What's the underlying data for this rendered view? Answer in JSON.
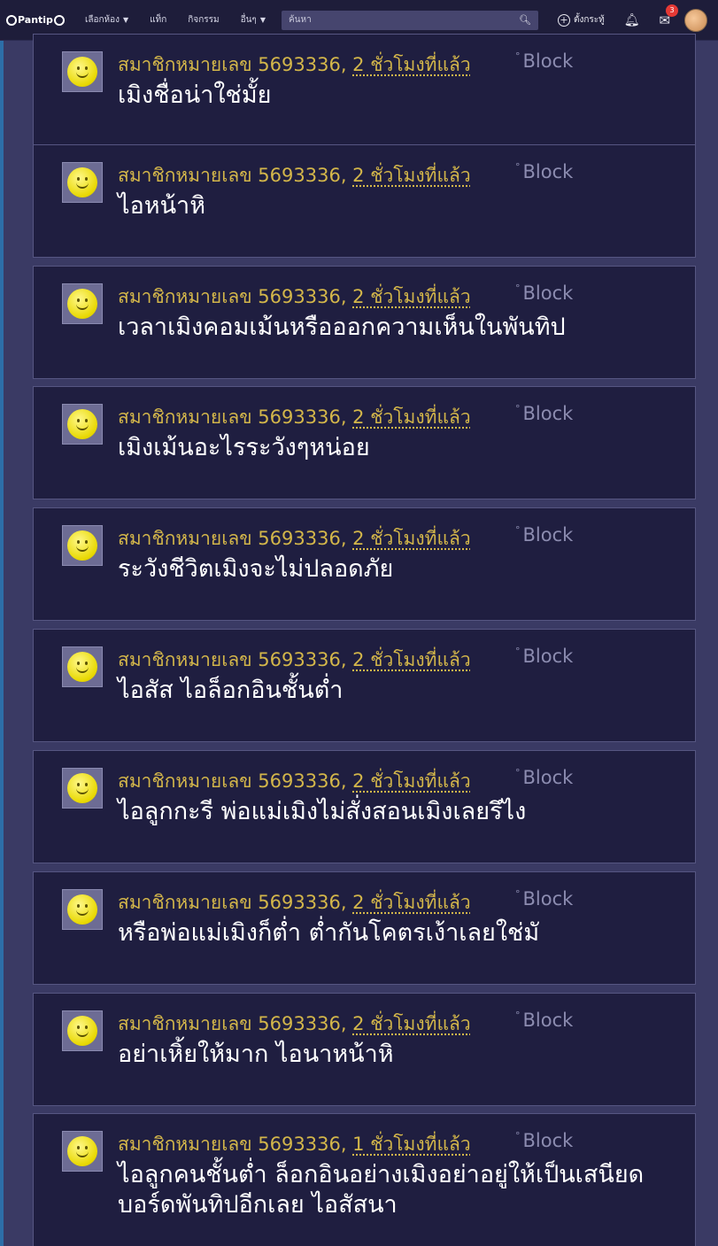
{
  "header": {
    "logo": "Pantip",
    "nav": [
      "เลือกห้อง",
      "แท็ก",
      "กิจกรรม",
      "อื่นๆ"
    ],
    "search_placeholder": "ค้นหา",
    "create_label": "ตั้งกระทู้",
    "mail_badge": "3"
  },
  "comments": [
    {
      "author": "สมาชิกหมายเลข 5693336",
      "time": "2 ชั่วโมงที่แล้ว",
      "block": "Block",
      "text": "เมิงชื่อน่าใช่มั้ย"
    },
    {
      "author": "สมาชิกหมายเลข 5693336",
      "time": "2 ชั่วโมงที่แล้ว",
      "block": "Block",
      "text": "ไอหน้าหิ"
    },
    {
      "author": "สมาชิกหมายเลข 5693336",
      "time": "2 ชั่วโมงที่แล้ว",
      "block": "Block",
      "text": "เวลาเมิงคอมเม้นหรือออกความเห็นในพันทิป"
    },
    {
      "author": "สมาชิกหมายเลข 5693336",
      "time": "2 ชั่วโมงที่แล้ว",
      "block": "Block",
      "text": "เมิงเม้นอะไรระวังๆหน่อย"
    },
    {
      "author": "สมาชิกหมายเลข 5693336",
      "time": "2 ชั่วโมงที่แล้ว",
      "block": "Block",
      "text": "ระวังชีวิตเมิงจะไม่ปลอดภัย"
    },
    {
      "author": "สมาชิกหมายเลข 5693336",
      "time": "2 ชั่วโมงที่แล้ว",
      "block": "Block",
      "text": "ไอสัส ไอล็อกอินชั้นต่ำ"
    },
    {
      "author": "สมาชิกหมายเลข 5693336",
      "time": "2 ชั่วโมงที่แล้ว",
      "block": "Block",
      "text": "ไอลูกกะรี พ่อแม่เมิงไม่สั่งสอนเมิงเลยรึไง"
    },
    {
      "author": "สมาชิกหมายเลข 5693336",
      "time": "2 ชั่วโมงที่แล้ว",
      "block": "Block",
      "text": "หรือพ่อแม่เมิงก็ต่ำ ต่ำกันโคตรเง้าเลยใช่มั"
    },
    {
      "author": "สมาชิกหมายเลข 5693336",
      "time": "2 ชั่วโมงที่แล้ว",
      "block": "Block",
      "text": "อย่าเหิ้ยให้มาก ไอนาหน้าหิ"
    },
    {
      "author": "สมาชิกหมายเลข 5693336",
      "time": "1 ชั่วโมงที่แล้ว",
      "block": "Block",
      "text": "ไอลูกคนชั้นต่ำ ล็อกอินอย่างเมิงอย่าอยู่ให้เป็นเสนียดบอร์ดพันทิปอีกเลย ไอสัสนา"
    }
  ]
}
